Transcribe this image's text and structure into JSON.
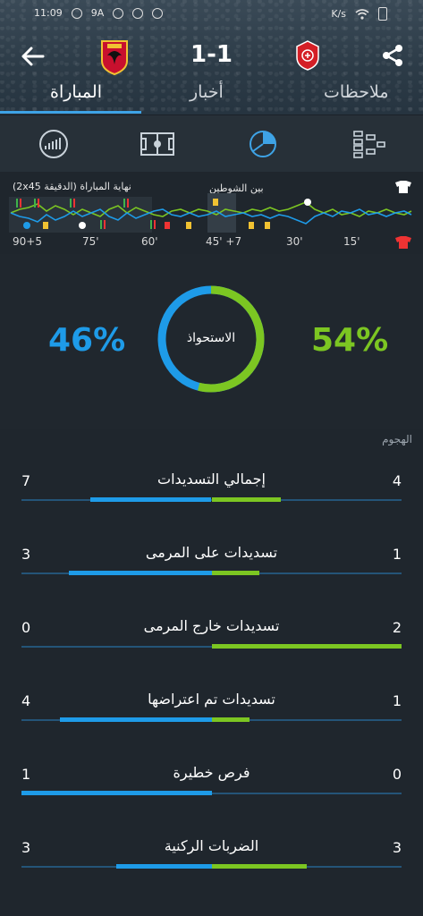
{
  "status_bar": {
    "time": "11:09",
    "battery_left": "9A",
    "network_speed": "K/s"
  },
  "header": {
    "score": "1-1",
    "tabs": [
      {
        "label": "المباراة",
        "active": true
      },
      {
        "label": "أخبار",
        "active": false
      },
      {
        "label": "ملاحظات",
        "active": false
      }
    ]
  },
  "timeline": {
    "end_label": "(2x45 الدقيقة) نهاية المباراة",
    "half_label": "بين الشوطين",
    "ticks": [
      "90+5",
      "75'",
      "60'",
      "45' +7",
      "30'",
      "15'"
    ]
  },
  "possession": {
    "label": "الاستحواذ",
    "left_pct": "46%",
    "right_pct": "54%",
    "left_value": 0.46,
    "right_value": 0.54,
    "left_color": "#1e9be8",
    "right_color": "#7cc622"
  },
  "attack": {
    "title": "الهجوم",
    "rows": [
      {
        "label": "إجمالي التسديدات",
        "left": "7",
        "right": "4"
      },
      {
        "label": "تسديدات على المرمى",
        "left": "3",
        "right": "1"
      },
      {
        "label": "تسديدات خارج المرمى",
        "left": "0",
        "right": "2"
      },
      {
        "label": "تسديدات تم اعتراضها",
        "left": "4",
        "right": "1"
      },
      {
        "label": "فرص خطيرة",
        "left": "1",
        "right": "0"
      },
      {
        "label": "الضربات الركنية",
        "left": "3",
        "right": "3"
      }
    ]
  },
  "colors": {
    "accent_blue": "#3ea3e6",
    "home_color": "#1e9be8",
    "away_color": "#7cc622"
  }
}
